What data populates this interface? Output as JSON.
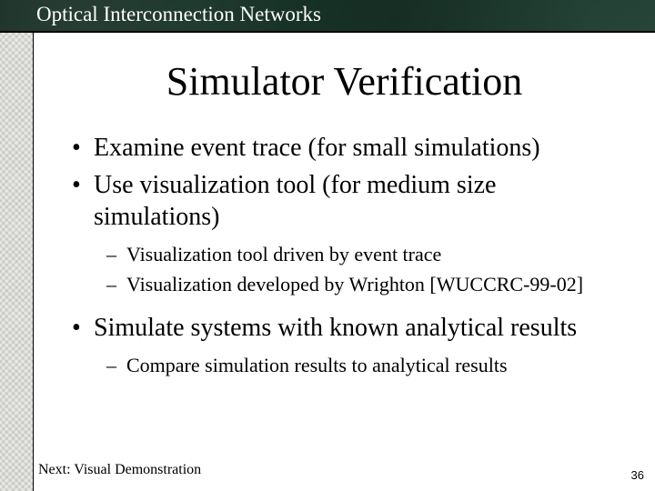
{
  "header": {
    "title": "Optical Interconnection Networks"
  },
  "slide": {
    "title": "Simulator Verification",
    "bullets": {
      "b1": "Examine event trace (for small simulations)",
      "b2": "Use visualization tool (for medium size simulations)",
      "b2_sub1": "Visualization tool driven by event trace",
      "b2_sub2": "Visualization developed by Wrighton [WUCCRC-99-02]",
      "b3": "Simulate systems with known analytical results",
      "b3_sub1": "Compare simulation results to analytical results"
    },
    "footer_next": "Next: Visual Demonstration",
    "page_number": "36"
  }
}
